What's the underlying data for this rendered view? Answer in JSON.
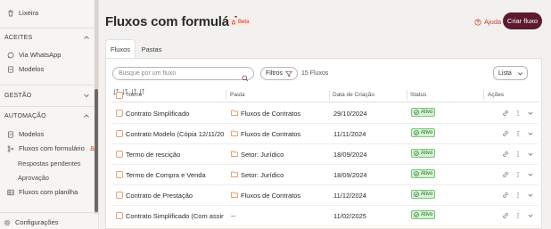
{
  "sidebar": {
    "lixeira": "Lixeira",
    "sections": {
      "aceites": "ACEITES",
      "gestao": "GESTÃO",
      "automacao": "AUTOMAÇÃO"
    },
    "via_whatsapp": "Via WhatsApp",
    "modelos_aceites": "Modelos",
    "modelos_automacao": "Modelos",
    "fluxos_formulario": "Fluxos com formulário",
    "respostas_pendentes": "Respostas pendentes",
    "aprovacao": "Aprovação",
    "fluxos_planilha": "Fluxos com planilha",
    "configuracoes": "Configurações"
  },
  "header": {
    "title": "Fluxos com formulário",
    "beta": "Beta",
    "help": "Ajuda",
    "create": "Criar fluxo"
  },
  "tabs": [
    "Fluxos",
    "Pastas"
  ],
  "toolbar": {
    "search_placeholder": "Busque por um fluxo",
    "filters": "Filtros",
    "count": "15 Fluxos",
    "view": "Lista"
  },
  "table": {
    "columns": [
      "Nome",
      "Pasta",
      "Data de Criação",
      "Status",
      "Ações"
    ],
    "rows": [
      {
        "name": "Contrato Simplificado",
        "folder": "Fluxos de Contratos",
        "date": "29/10/2024",
        "status": "Ativo"
      },
      {
        "name": "Contrato Modelo (Cópia 12/11/2024...",
        "folder": "Fluxos de Contratos",
        "date": "11/11/2024",
        "status": "Ativo"
      },
      {
        "name": "Termo de rescição",
        "folder": "Setor: Jurídico",
        "date": "18/09/2024",
        "status": "Ativo"
      },
      {
        "name": "Termo de Compra e Venda",
        "folder": "Setor: Jurídico",
        "date": "18/09/2024",
        "status": "Ativo"
      },
      {
        "name": "Contrato de Prestação",
        "folder": "Fluxos de Contratos",
        "date": "11/12/2024",
        "status": "Ativo"
      },
      {
        "name": "Contrato Simplificado (Com assina...",
        "folder": "--",
        "date": "11/02/2025",
        "status": "Ativo"
      }
    ]
  },
  "colors": {
    "brand": "#5c1a2e",
    "accent": "#c0392b",
    "status_active_bg": "#d7f2d2",
    "status_active_fg": "#1d6b2a"
  }
}
